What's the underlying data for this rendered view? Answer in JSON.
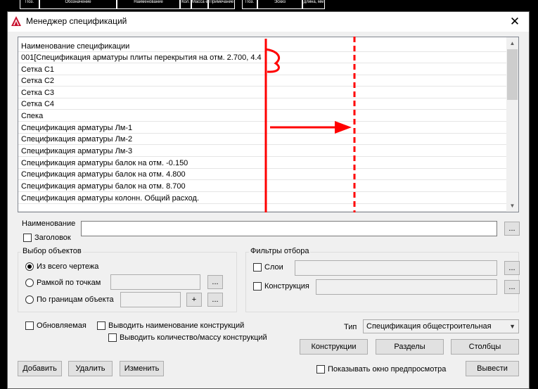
{
  "top_header": {
    "cells": [
      "Поз.",
      "Обозначение",
      "Наименование",
      "Кол.",
      "Масса ед. кг",
      "Примечание",
      "Поз.",
      "Эскиз",
      "длина, мм"
    ]
  },
  "window": {
    "title": "Менеджер спецификаций",
    "close_glyph": "✕"
  },
  "list": {
    "header": "Наименование спецификации",
    "items": [
      "001[Спецификация арматуры плиты перекрытия на отм. 2.700, 4.4",
      "Сетка С1",
      "Сетка С2",
      "Сетка С3",
      "Сетка С4",
      "Спека",
      "Спецификация арматуры Лм-1",
      "Спецификация арматуры Лм-2",
      "Спецификация арматуры Лм-3",
      "Спецификация арматуры балок на отм. -0.150",
      "Спецификация арматуры балок на отм. 4.800",
      "Спецификация арматуры балок на отм. 8.700",
      "Спецификация арматуры колонн. Общий расход."
    ],
    "scroll_up": "▲",
    "scroll_down": "▼"
  },
  "name_field": {
    "label": "Наименование",
    "value": "",
    "browse": "..."
  },
  "header_checkbox": {
    "label": "Заголовок",
    "checked": false
  },
  "object_selection": {
    "title": "Выбор объектов",
    "whole_drawing": {
      "label": "Из всего чертежа",
      "selected": true
    },
    "frame_points": {
      "label": "Рамкой по точкам",
      "selected": false,
      "browse": "..."
    },
    "object_bounds": {
      "label": "По границам объекта",
      "selected": false,
      "add": "+",
      "browse": "..."
    }
  },
  "filters": {
    "title": "Фильтры отбора",
    "layers": {
      "label": "Слои",
      "checked": false,
      "browse": "..."
    },
    "construction": {
      "label": "Конструкция",
      "checked": false,
      "browse": "..."
    }
  },
  "options": {
    "updatable": {
      "label": "Обновляемая",
      "checked": false
    },
    "show_construction_name": {
      "label": "Выводить наименование конструкций",
      "checked": false
    },
    "show_quantity_mass": {
      "label": "Выводить количество/массу конструкций",
      "checked": false
    }
  },
  "type": {
    "label": "Тип",
    "selected": "Спецификация общестроительная"
  },
  "buttons": {
    "constructions": "Конструкции",
    "sections": "Разделы",
    "columns": "Столбцы",
    "add": "Добавить",
    "delete": "Удалить",
    "change": "Изменить",
    "output": "Вывести"
  },
  "preview": {
    "label": "Показывать окно предпросмотра",
    "checked": false
  },
  "colors": {
    "annotation_red": "#ff0000",
    "scroll_thumb": "#cdcdcd"
  }
}
